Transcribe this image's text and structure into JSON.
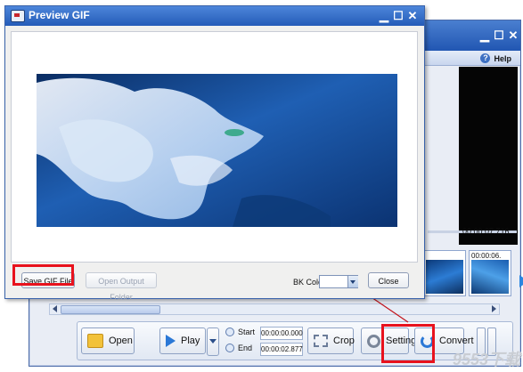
{
  "back_window": {
    "minimize": "▁",
    "maximize": "☐",
    "close": "✕",
    "help_label": "Help",
    "timeline_end": "00:00:07.716",
    "thumb2_time": "00:00:06.",
    "toolbar": {
      "open_label": "Open",
      "play_label": "Play",
      "start_label": "Start",
      "start_value": "00:00:00.000",
      "end_label": "End",
      "end_value": "00:00:02.877",
      "crop_label": "Crop",
      "setting_label": "Setting",
      "convert_label": "Convert"
    }
  },
  "preview_dialog": {
    "title": "Preview GIF",
    "minimize": "▁",
    "maximize": "☐",
    "close": "✕",
    "save_gif_label": "Save GIF File",
    "open_output_label": "Open Output Folder",
    "bk_color_label": "BK Color",
    "close_label": "Close"
  },
  "colors": {
    "highlight": "#e8121d",
    "titlebar": "#2b63c1",
    "arrow": "#c3141c"
  },
  "watermark": "9553下载",
  "icons": [
    "folder-icon",
    "play-icon",
    "clock-icon",
    "crop-icon",
    "gear-icon",
    "convert-icon",
    "help-icon",
    "app-icon"
  ]
}
